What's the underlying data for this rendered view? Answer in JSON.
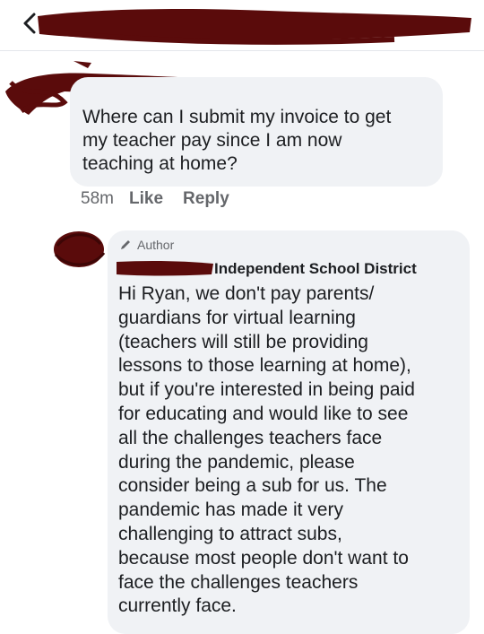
{
  "header": {
    "back_icon": "chevron-left-icon",
    "title_redacted": true
  },
  "comment": {
    "author_redacted": true,
    "text": "Where can I submit my invoice to get\nmy teacher pay since I am now\nteaching at home?",
    "timestamp": "58m",
    "like_label": "Like",
    "reply_label": "Reply"
  },
  "reply": {
    "avatar_redacted": true,
    "badge_icon": "pencil-icon",
    "badge_label": "Author",
    "org_name": "Independent School District",
    "text": "Hi Ryan, we don't pay parents/\nguardians for virtual learning\n(teachers will still be providing\nlessons to those learning at home),\nbut if you're interested in being paid\nfor educating and would like to see\nall the challenges teachers face\nduring the pandemic, please\nconsider being a sub for us. The\npandemic has made it very\nchallenging to attract subs,\nbecause most people don't want to\nface the challenges teachers\ncurrently face."
  },
  "colors": {
    "redaction": "#5a0b0b",
    "bubble": "#f0f2f5",
    "meta_text": "#65676b"
  }
}
